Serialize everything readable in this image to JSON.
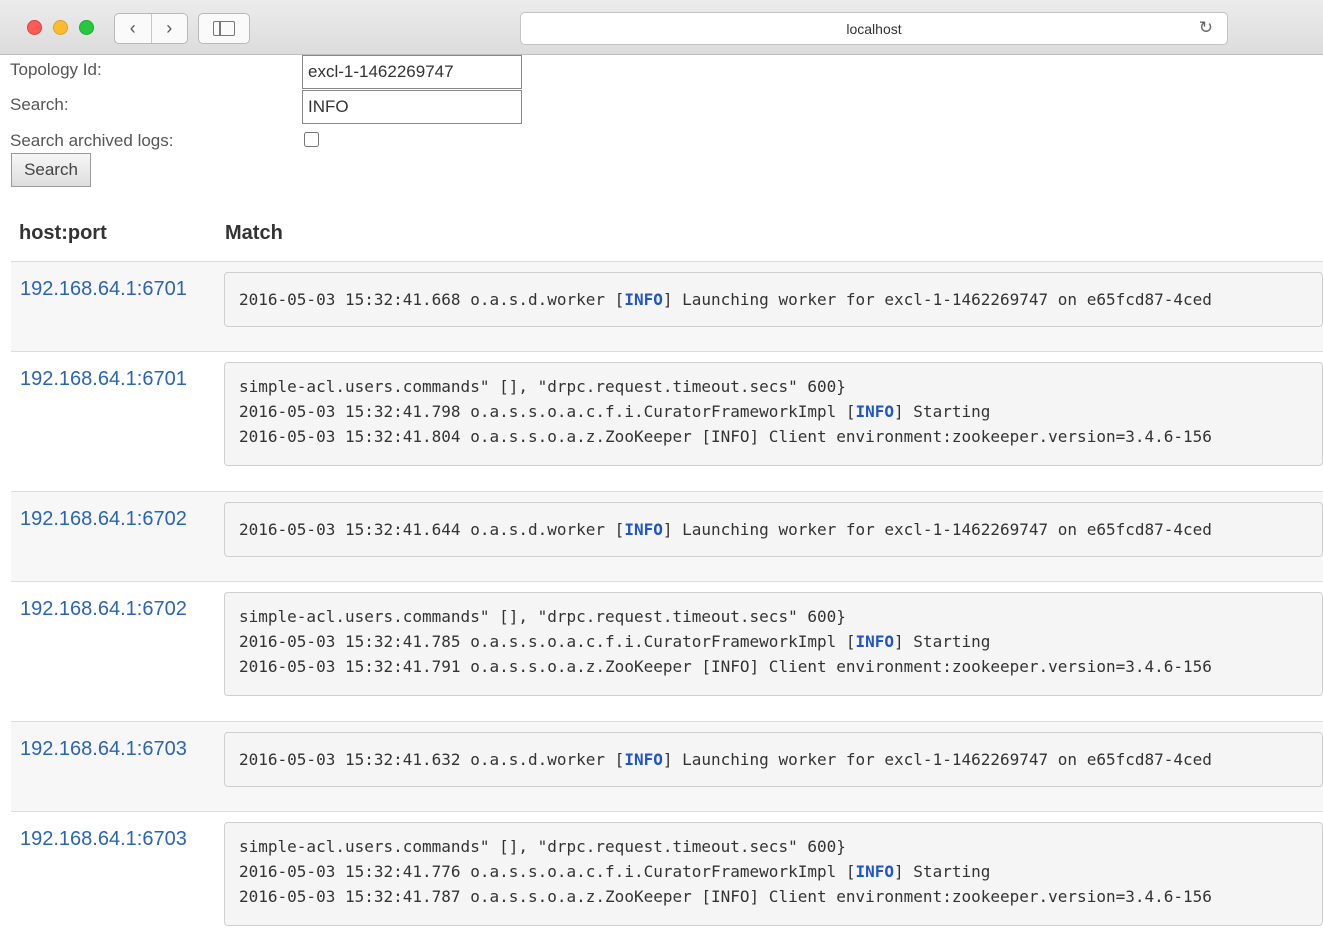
{
  "browser": {
    "url": "localhost",
    "back_glyph": "‹",
    "forward_glyph": "›",
    "reload_glyph": "↻"
  },
  "form": {
    "topology_label": "Topology Id:",
    "topology_value": "excl-1-1462269747",
    "search_label": "Search:",
    "search_value": "INFO",
    "archived_label": "Search archived logs:",
    "archived_checked": false,
    "search_button": "Search"
  },
  "table": {
    "headers": [
      "host:port",
      "Match"
    ],
    "rows": [
      {
        "host": "192.168.64.1:6701",
        "lines": [
          "2016-05-03 15:32:41.668 o.a.s.d.worker [INFO] Launching worker for excl-1-1462269747 on e65fcd87-4ced"
        ]
      },
      {
        "host": "192.168.64.1:6701",
        "lines": [
          "simple-acl.users.commands\" [], \"drpc.request.timeout.secs\" 600}",
          "2016-05-03 15:32:41.798 o.a.s.s.o.a.c.f.i.CuratorFrameworkImpl [INFO] Starting",
          "2016-05-03 15:32:41.804 o.a.s.s.o.a.z.ZooKeeper [INFO] Client environment:zookeeper.version=3.4.6-156"
        ]
      },
      {
        "host": "192.168.64.1:6702",
        "lines": [
          "2016-05-03 15:32:41.644 o.a.s.d.worker [INFO] Launching worker for excl-1-1462269747 on e65fcd87-4ced"
        ]
      },
      {
        "host": "192.168.64.1:6702",
        "lines": [
          "simple-acl.users.commands\" [], \"drpc.request.timeout.secs\" 600}",
          "2016-05-03 15:32:41.785 o.a.s.s.o.a.c.f.i.CuratorFrameworkImpl [INFO] Starting",
          "2016-05-03 15:32:41.791 o.a.s.s.o.a.z.ZooKeeper [INFO] Client environment:zookeeper.version=3.4.6-156"
        ]
      },
      {
        "host": "192.168.64.1:6703",
        "lines": [
          "2016-05-03 15:32:41.632 o.a.s.d.worker [INFO] Launching worker for excl-1-1462269747 on e65fcd87-4ced"
        ]
      },
      {
        "host": "192.168.64.1:6703",
        "lines": [
          "simple-acl.users.commands\" [], \"drpc.request.timeout.secs\" 600}",
          "2016-05-03 15:32:41.776 o.a.s.s.o.a.c.f.i.CuratorFrameworkImpl [INFO] Starting",
          "2016-05-03 15:32:41.787 o.a.s.s.o.a.z.ZooKeeper [INFO] Client environment:zookeeper.version=3.4.6-156"
        ]
      }
    ],
    "highlight": "[INFO]"
  },
  "colors": {
    "link": "#2a64b6",
    "highlight": "#1f55c7"
  }
}
